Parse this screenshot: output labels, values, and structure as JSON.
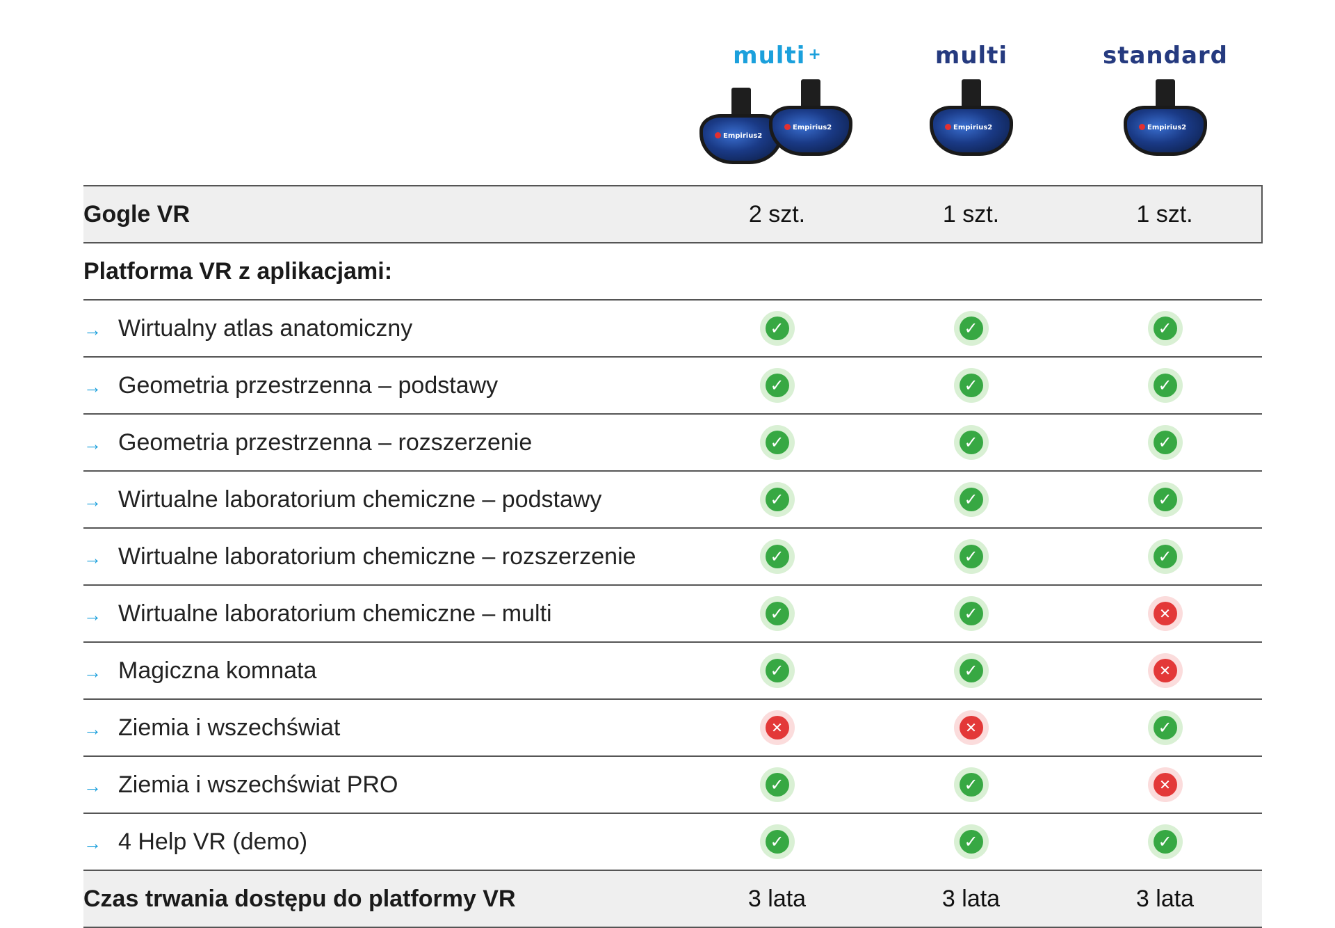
{
  "plans": [
    {
      "name": "multi",
      "suffix": "+",
      "color": "#1ba0dc",
      "headsets": 2
    },
    {
      "name": "multi",
      "suffix": "",
      "color": "#253a7f",
      "headsets": 1
    },
    {
      "name": "standard",
      "suffix": "",
      "color": "#253a7f",
      "headsets": 1
    }
  ],
  "headset_brand": "Empirius2",
  "goggles_row": {
    "label": "Gogle VR",
    "values": [
      "2 szt.",
      "1 szt.",
      "1 szt."
    ]
  },
  "platform_heading": "Platforma VR z aplikacjami:",
  "arrow_icon": "→",
  "check_icon": "✓",
  "cross_icon": "✕",
  "apps": [
    {
      "label": "Wirtualny atlas anatomiczny",
      "included": [
        true,
        true,
        true
      ]
    },
    {
      "label": "Geometria przestrzenna – podstawy",
      "included": [
        true,
        true,
        true
      ]
    },
    {
      "label": "Geometria przestrzenna – rozszerzenie",
      "included": [
        true,
        true,
        true
      ]
    },
    {
      "label": "Wirtualne laboratorium chemiczne – podstawy",
      "included": [
        true,
        true,
        true
      ]
    },
    {
      "label": "Wirtualne laboratorium chemiczne – rozszerzenie",
      "included": [
        true,
        true,
        true
      ]
    },
    {
      "label": "Wirtualne laboratorium chemiczne – multi",
      "included": [
        true,
        true,
        false
      ]
    },
    {
      "label": "Magiczna komnata",
      "included": [
        true,
        true,
        false
      ]
    },
    {
      "label": "Ziemia i wszechświat",
      "included": [
        false,
        false,
        true
      ]
    },
    {
      "label": "Ziemia i wszechświat PRO",
      "included": [
        true,
        true,
        false
      ]
    },
    {
      "label": "4 Help VR (demo)",
      "included": [
        true,
        true,
        true
      ]
    }
  ],
  "duration_row": {
    "label": "Czas trwania dostępu do platformy VR",
    "values": [
      "3 lata",
      "3 lata",
      "3 lata"
    ]
  }
}
